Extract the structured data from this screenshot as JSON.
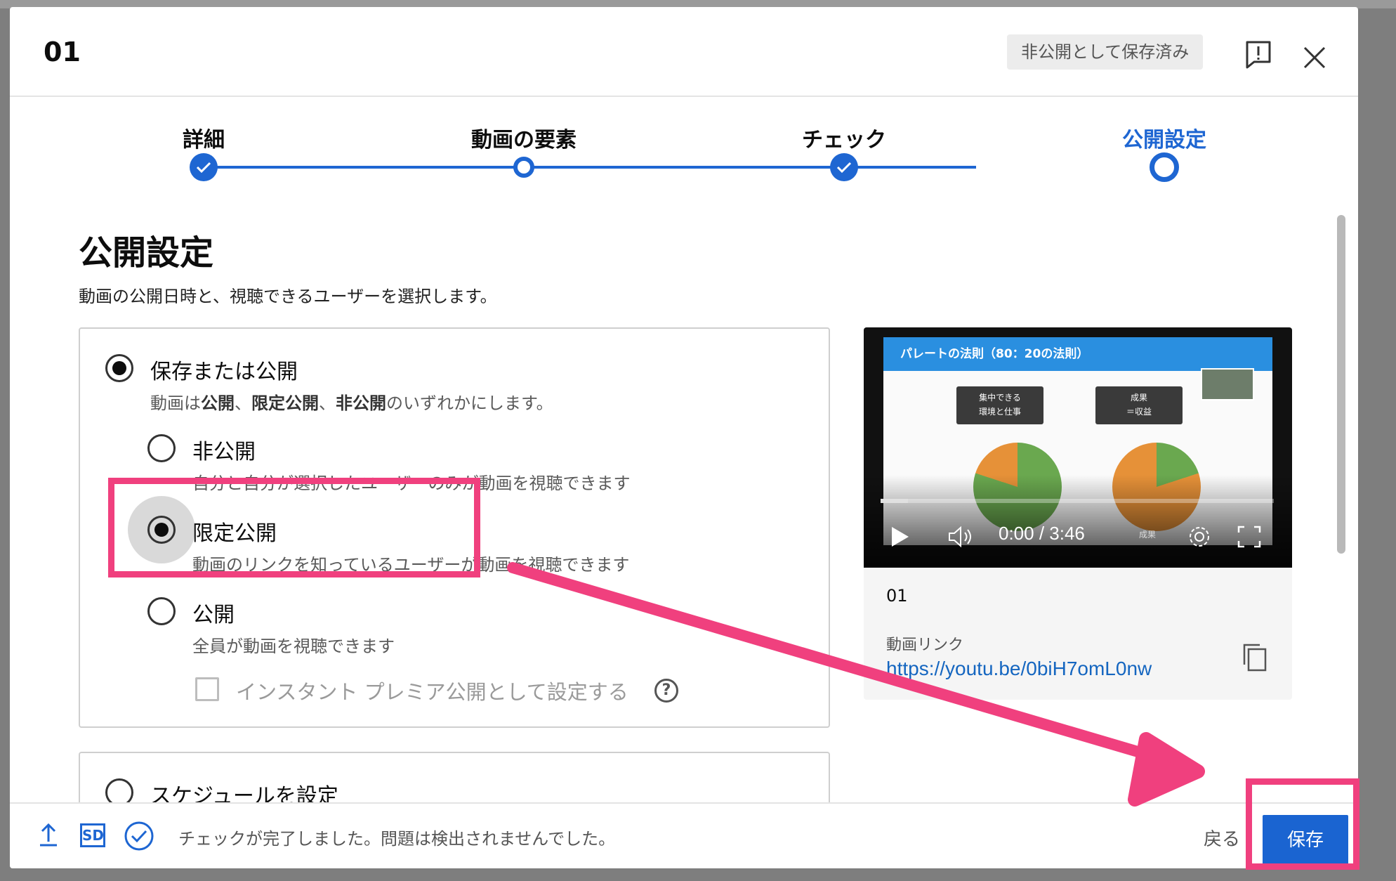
{
  "dialog": {
    "title": "01",
    "saved_badge": "非公開として保存済み",
    "feedback_icon": "feedback-icon",
    "close_icon": "close-icon"
  },
  "stepper": {
    "steps": [
      {
        "label": "詳細",
        "state": "complete"
      },
      {
        "label": "動画の要素",
        "state": "visited"
      },
      {
        "label": "チェック",
        "state": "complete"
      },
      {
        "label": "公開設定",
        "state": "current"
      }
    ],
    "accent": "#1e66d2"
  },
  "visibility": {
    "heading": "公開設定",
    "subtitle": "動画の公開日時と、視聴できるユーザーを選択します。",
    "save_or_publish": {
      "label": "保存または公開",
      "desc_prefix": "動画は",
      "desc_public": "公開",
      "desc_sep1": "、",
      "desc_unlisted": "限定公開",
      "desc_sep2": "、",
      "desc_private": "非公開",
      "desc_suffix": "のいずれかにします。",
      "selected": true
    },
    "options": [
      {
        "label": "非公開",
        "desc": "自分と自分が選択したユーザーのみが動画を視聴できます",
        "selected": false
      },
      {
        "label": "限定公開",
        "desc": "動画のリンクを知っているユーザーが動画を視聴できます",
        "selected": true
      },
      {
        "label": "公開",
        "desc": "全員が動画を視聴できます",
        "selected": false
      }
    ],
    "premiere_label": "インスタント プレミア公開として設定する",
    "help_glyph": "?",
    "schedule_label": "スケジュールを設定"
  },
  "preview": {
    "slide_title": "パレートの法則（80：20の法則）",
    "bubble_left": "集中できる\n環境と仕事",
    "bubble_right": "成果\n＝収益",
    "slide_footer": "成果",
    "time": "0:00 / 3:46",
    "progress": 0.07,
    "video_title": "01",
    "link_caption": "動画リンク",
    "link": "https://youtu.be/0biH7omL0nw"
  },
  "footer": {
    "status": "チェックが完了しました。問題は検出されませんでした。",
    "sd_badge": "SD",
    "back_label": "戻る",
    "save_label": "保存"
  },
  "annotation_color": "#f0407e"
}
